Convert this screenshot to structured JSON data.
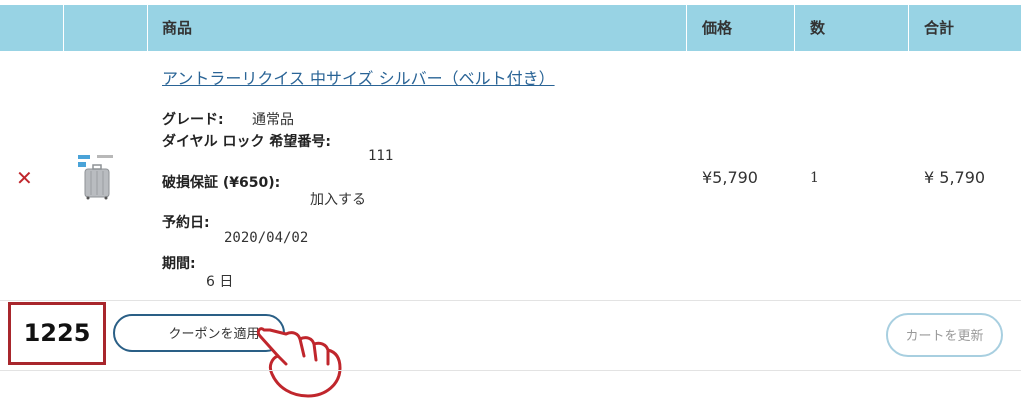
{
  "header": {
    "product": "商品",
    "price": "価格",
    "quantity": "数",
    "total": "合計"
  },
  "item": {
    "remove_icon": "close-icon",
    "name": "アントラーリクイス 中サイズ シルバー（ベルト付き）",
    "options": [
      {
        "label": "グレード:",
        "value": "通常品"
      },
      {
        "label": "ダイヤル ロック 希望番号:",
        "value": "111"
      },
      {
        "label": "破損保証 (¥650):",
        "value": "加入する"
      },
      {
        "label": "予約日:",
        "value": "2020/04/02"
      },
      {
        "label": "期間:",
        "value": "6 日"
      }
    ],
    "price": "¥5,790",
    "quantity": "1",
    "total": "¥ 5,790"
  },
  "footer": {
    "annotation_number": "1225",
    "coupon_button": "クーポンを適用",
    "update_cart_button": "カートを更新"
  },
  "colors": {
    "header_bg": "#98d3e4",
    "link": "#2a6496",
    "remove": "#c0262c",
    "annotation_border": "#a8262c",
    "coupon_border": "#2a5f86",
    "update_border": "#a8cfe0"
  }
}
